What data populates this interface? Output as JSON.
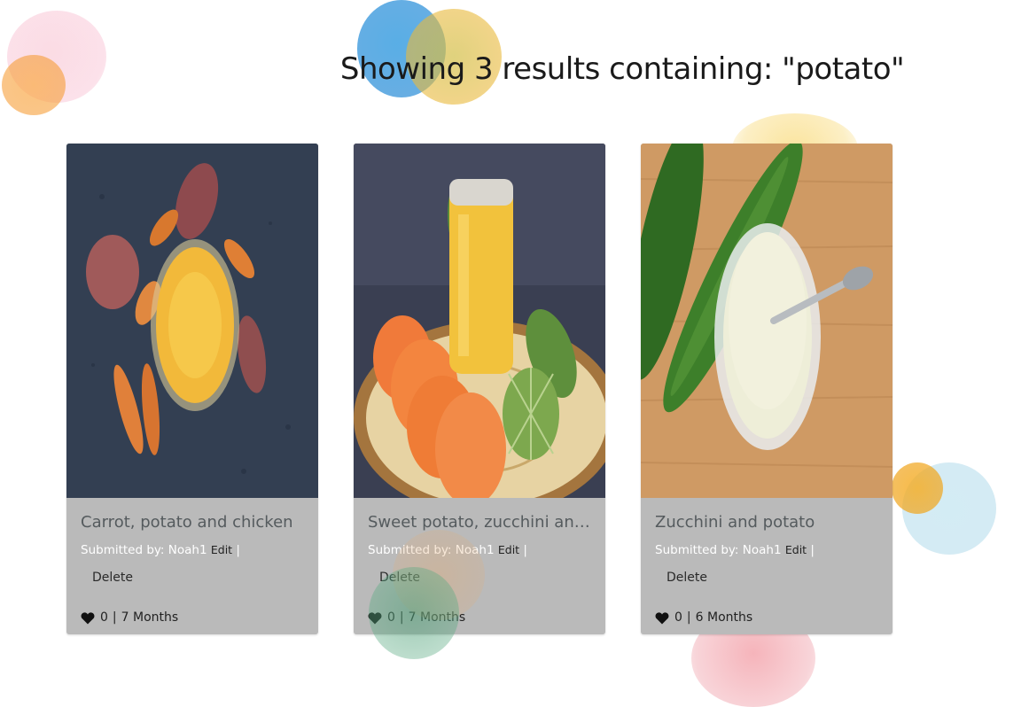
{
  "heading": "Showing 3 results containing: \"potato\"",
  "colors": {
    "card_bg": "#bababa",
    "title_text": "#555b5e",
    "submitted_text": "#ffffff",
    "link_text": "#222222"
  },
  "cards": [
    {
      "title": "Carrot, potato and chicken",
      "submitted_label": "Submitted by:",
      "author": "Noah1",
      "edit_label": "Edit",
      "separator": "|",
      "delete_label": "Delete",
      "likes": "0",
      "meta_separator": "|",
      "age": "7 Months"
    },
    {
      "title": "Sweet potato, zucchini and l...",
      "submitted_label": "Submitted by:",
      "author": "Noah1",
      "edit_label": "Edit",
      "separator": "|",
      "delete_label": "Delete",
      "likes": "0",
      "meta_separator": "|",
      "age": "7 Months"
    },
    {
      "title": "Zucchini and potato",
      "submitted_label": "Submitted by:",
      "author": "Noah1",
      "edit_label": "Edit",
      "separator": "|",
      "delete_label": "Delete",
      "likes": "0",
      "meta_separator": "|",
      "age": "6 Months"
    }
  ]
}
